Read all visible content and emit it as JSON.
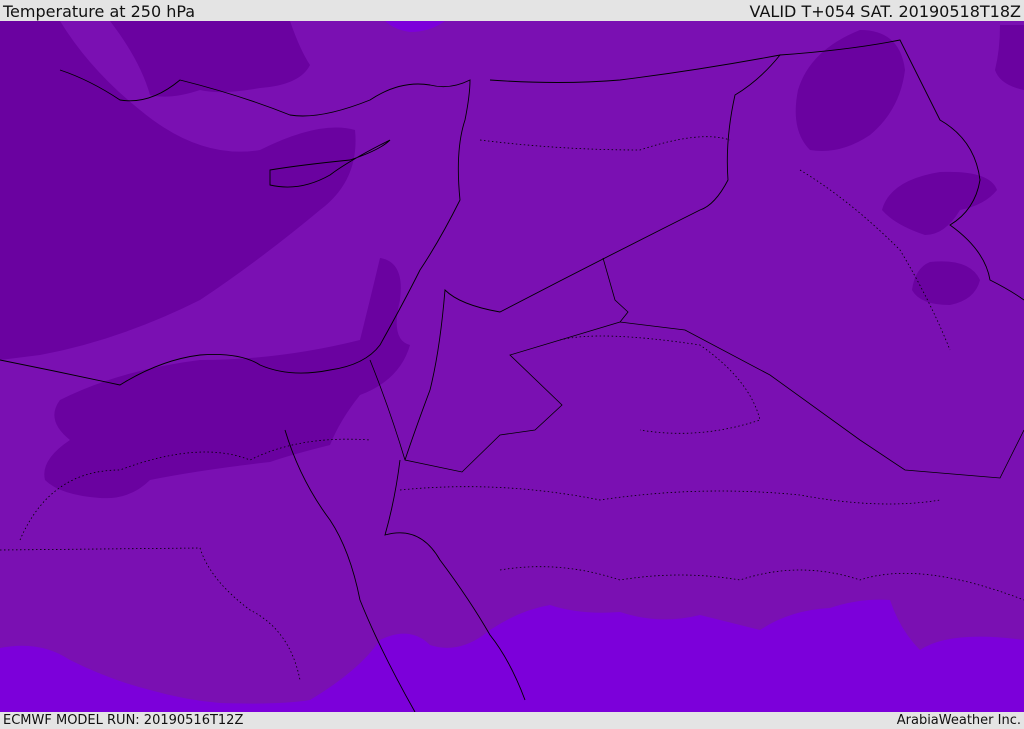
{
  "header": {
    "title": "Temperature at 250 hPa",
    "valid": "VALID T+054 SAT. 20190518T18Z"
  },
  "footer": {
    "model_run": "ECMWF MODEL RUN: 20190516T12Z",
    "credit": "ArabiaWeather Inc."
  },
  "colors": {
    "base": "#7a10b2",
    "cold": "#6a02a0",
    "warm": "#7c00da",
    "line": "#000000"
  }
}
